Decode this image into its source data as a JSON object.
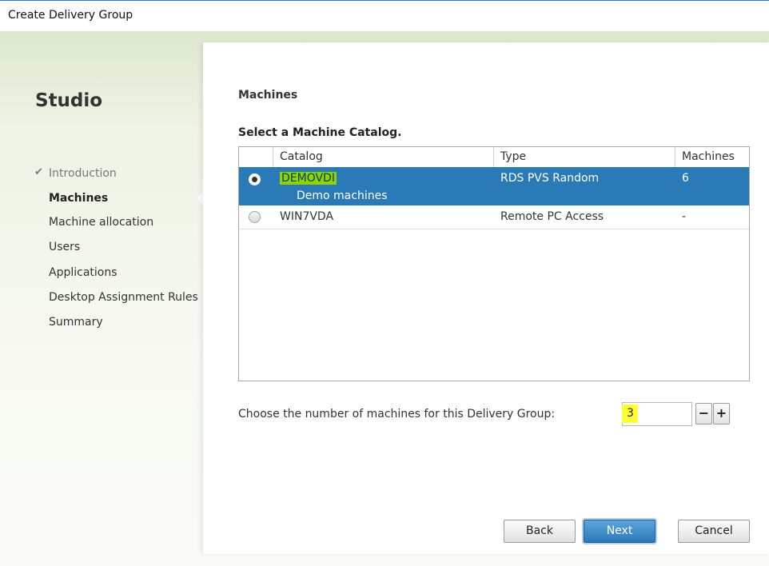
{
  "window": {
    "title": "Create Delivery Group"
  },
  "sidebar": {
    "app_name": "Studio",
    "steps": [
      {
        "label": "Introduction",
        "state": "done"
      },
      {
        "label": "Machines",
        "state": "active"
      },
      {
        "label": "Machine allocation",
        "state": "pending"
      },
      {
        "label": "Users",
        "state": "pending"
      },
      {
        "label": "Applications",
        "state": "pending"
      },
      {
        "label": "Desktop Assignment Rules",
        "state": "pending"
      },
      {
        "label": "Summary",
        "state": "pending"
      }
    ],
    "check_glyph": "✔"
  },
  "main": {
    "heading": "Machines",
    "subheading": "Select a Machine Catalog.",
    "table": {
      "columns": [
        "Catalog",
        "Type",
        "Machines"
      ],
      "rows": [
        {
          "catalog": "DEMOVDI",
          "description": "Demo machines",
          "type": "RDS PVS Random",
          "machines": "6",
          "selected": true
        },
        {
          "catalog": "WIN7VDA",
          "description": "",
          "type": "Remote PC Access",
          "machines": "-",
          "selected": false
        }
      ]
    },
    "count_label": "Choose the number of machines for this Delivery Group:",
    "count_value": "3",
    "minus_label": "−",
    "plus_label": "+"
  },
  "footer": {
    "back_label": "Back",
    "next_label": "Next",
    "cancel_label": "Cancel"
  },
  "colors": {
    "selection": "#2a7ab8",
    "highlight_green": "#8ed400",
    "highlight_yellow": "#ffff33"
  },
  "icons": {
    "check": "check-icon",
    "radio_selected": "radio-selected-icon",
    "radio_unselected": "radio-unselected-icon"
  }
}
